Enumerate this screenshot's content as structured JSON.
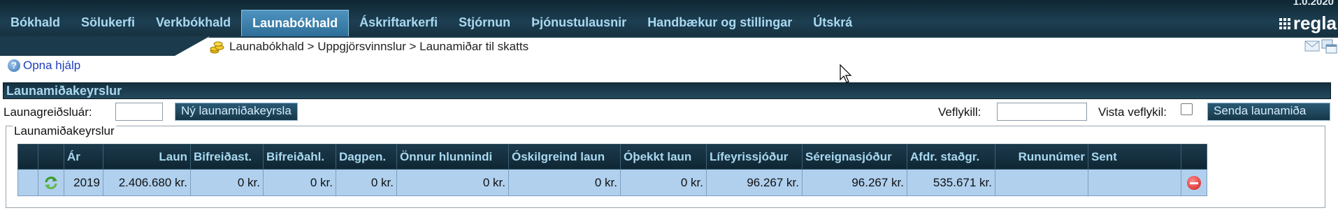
{
  "app": {
    "version": "1.0.2020",
    "logo_text": "regla",
    "accent": "#2d6f98",
    "header_dark": "#0f2633"
  },
  "menu": [
    {
      "label": "Bókhald",
      "active": false
    },
    {
      "label": "Sölukerfi",
      "active": false
    },
    {
      "label": "Verkbókhald",
      "active": false
    },
    {
      "label": "Launabókhald",
      "active": true
    },
    {
      "label": "Áskriftarkerfi",
      "active": false
    },
    {
      "label": "Stjórnun",
      "active": false
    },
    {
      "label": "Þjónustulausnir",
      "active": false
    },
    {
      "label": "Handbækur og stillingar",
      "active": false
    },
    {
      "label": "Útskrá",
      "active": false
    }
  ],
  "breadcrumb": {
    "icon": "coins-icon",
    "text": "Launabókhald > Uppgjörsvinnslur > Launamiðar til skatts"
  },
  "header_icons": [
    "mail-icon",
    "windows-icon"
  ],
  "help": {
    "icon": "help-icon",
    "label": "Opna hjálp"
  },
  "section": {
    "title": "Launamiðakeyrslur"
  },
  "form": {
    "payer_label": "Launagreiðsluár:",
    "payer_value": "",
    "new_button": "Ný launamiðakeyrsla",
    "key_label": "Veflykill:",
    "key_value": "",
    "save_key_label": "Vista veflykil:",
    "save_key_checked": false,
    "send_button": "Senda launamiða"
  },
  "group": {
    "legend": "Launamiðakeyrslur",
    "columns": [
      "",
      "",
      "Ár",
      "Laun",
      "Bifreiðast.",
      "Bifreiðahl.",
      "Dagpen.",
      "Önnur hlunnindi",
      "Óskilgreind laun",
      "Óþekkt laun",
      "Lífeyrissjóður",
      "Séreignasjóður",
      "Afdr. staðgr.",
      "Rununúmer",
      "Sent",
      ""
    ],
    "rows": [
      {
        "ar": "2019",
        "laun": "2.406.680 kr.",
        "bifreidast": "0 kr.",
        "bifreidahl": "0 kr.",
        "dagpen": "0 kr.",
        "onnur": "0 kr.",
        "oskilgreind": "0 kr.",
        "othekkt": "0 kr.",
        "lifeyris": "96.267 kr.",
        "sereign": "96.267 kr.",
        "afdr": "535.671 kr.",
        "runu": "",
        "sent": "",
        "row_icon": "refresh-icon",
        "action_icon": "delete-icon"
      }
    ]
  }
}
